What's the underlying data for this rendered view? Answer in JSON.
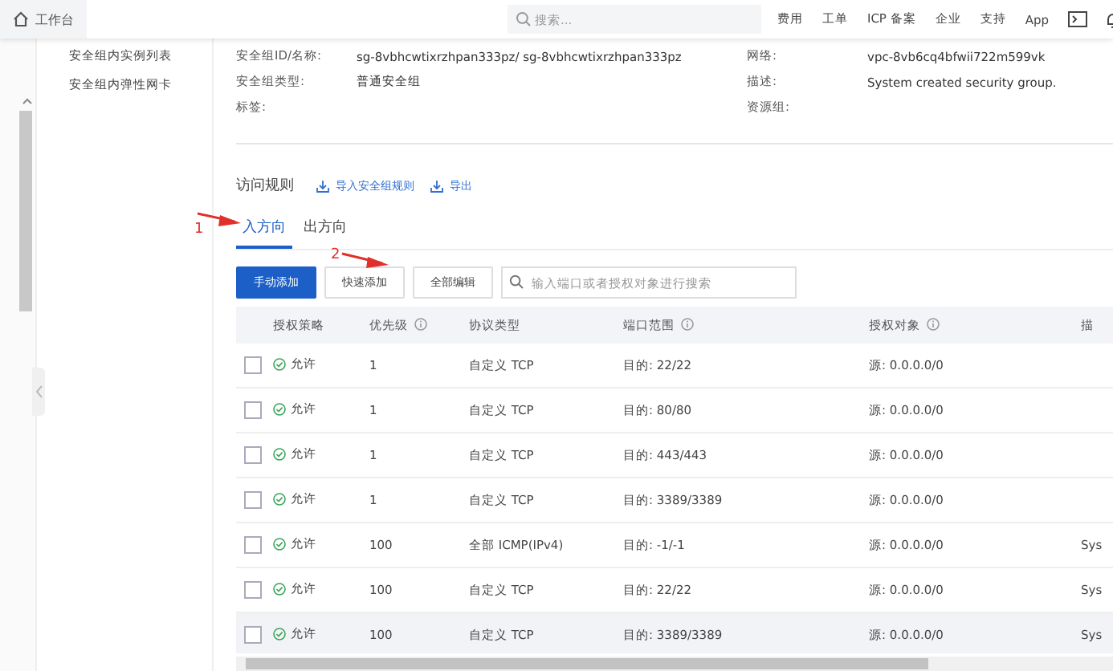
{
  "topbar": {
    "home_label": "工作台",
    "search": {
      "placeholder": "搜索..."
    },
    "nav": [
      "费用",
      "工单",
      "ICP 备案",
      "企业",
      "支持",
      "App"
    ]
  },
  "sidebar": {
    "items": [
      {
        "label": "安全组内实例列表",
        "selected": false
      },
      {
        "label": "安全组内弹性网卡",
        "selected": false
      }
    ]
  },
  "info": {
    "fields": [
      {
        "label": "安全组ID/名称:",
        "value": "sg-8vbhcwtixrzhpan333pz/ sg-8vbhcwtixrzhpan333pz"
      },
      {
        "label": "网络:",
        "value": "vpc-8vb6cq4bfwii722m599vk"
      },
      {
        "label": "安全组类型:",
        "value": "普通安全组"
      },
      {
        "label": "描述:",
        "value": "System created security group."
      },
      {
        "label": "标签:"
      },
      {
        "label": "资源组:"
      }
    ]
  },
  "rules": {
    "title": "访问规则",
    "actions": [
      "导入安全组规则",
      "导出"
    ],
    "tabs": [
      {
        "label": "入方向",
        "selected": true
      },
      {
        "label": "出方向",
        "selected": false
      }
    ],
    "buttons": [
      {
        "label": "手动添加",
        "kind": "primary"
      },
      {
        "label": "快速添加",
        "kind": "default"
      },
      {
        "label": "全部编辑",
        "kind": "default"
      }
    ],
    "search": {
      "placeholder": "输入端口或者授权对象进行搜索"
    },
    "table": {
      "columns": [
        {
          "label": "授权策略",
          "info": false
        },
        {
          "label": "优先级",
          "info": true
        },
        {
          "label": "协议类型",
          "info": false
        },
        {
          "label": "端口范围",
          "info": true
        },
        {
          "label": "授权对象",
          "info": true
        },
        {
          "label": "描",
          "info": false
        }
      ],
      "rows": [
        {
          "checked": false,
          "highlighted": false,
          "policy": "允许",
          "priority": "1",
          "protocol": "自定义 TCP",
          "port": "目的: 22/22",
          "object": "源: 0.0.0.0/0"
        },
        {
          "checked": false,
          "highlighted": false,
          "policy": "允许",
          "priority": "1",
          "protocol": "自定义 TCP",
          "port": "目的: 80/80",
          "object": "源: 0.0.0.0/0"
        },
        {
          "checked": false,
          "highlighted": false,
          "policy": "允许",
          "priority": "1",
          "protocol": "自定义 TCP",
          "port": "目的: 443/443",
          "object": "源: 0.0.0.0/0"
        },
        {
          "checked": false,
          "highlighted": false,
          "policy": "允许",
          "priority": "1",
          "protocol": "自定义 TCP",
          "port": "目的: 3389/3389",
          "object": "源: 0.0.0.0/0"
        },
        {
          "checked": false,
          "highlighted": false,
          "policy": "允许",
          "priority": "100",
          "protocol": "全部 ICMP(IPv4)",
          "port": "目的: -1/-1",
          "object": "源: 0.0.0.0/0",
          "description": "Sys"
        },
        {
          "checked": false,
          "highlighted": false,
          "policy": "允许",
          "priority": "100",
          "protocol": "自定义 TCP",
          "port": "目的: 22/22",
          "object": "源: 0.0.0.0/0",
          "description": "Sys"
        },
        {
          "checked": false,
          "highlighted": true,
          "policy": "允许",
          "priority": "100",
          "protocol": "自定义 TCP",
          "port": "目的: 3389/3389",
          "object": "源: 0.0.0.0/0",
          "description": "Sys"
        }
      ]
    }
  },
  "annotations": [
    {
      "label": "1"
    },
    {
      "label": "2"
    }
  ]
}
